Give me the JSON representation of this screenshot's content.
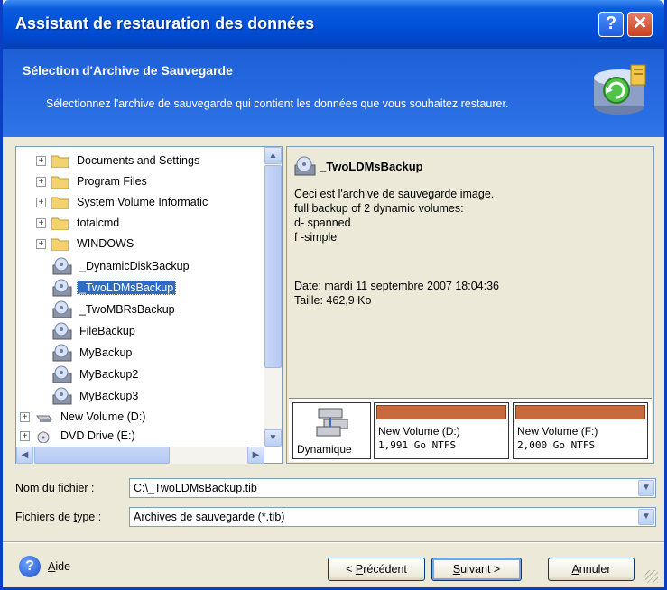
{
  "window": {
    "title": "Assistant de restauration des données",
    "help_glyph": "?",
    "close_glyph": "✕"
  },
  "header": {
    "title": "Sélection d'Archive de Sauvegarde",
    "description": "Sélectionnez l'archive de sauvegarde qui contient les données que vous souhaitez restaurer."
  },
  "tree": {
    "items": [
      {
        "label": "Documents and Settings",
        "kind": "folder",
        "expander": "+"
      },
      {
        "label": "Program Files",
        "kind": "folder",
        "expander": "+"
      },
      {
        "label": "System Volume Informatic",
        "kind": "folder",
        "expander": "+"
      },
      {
        "label": "totalcmd",
        "kind": "folder",
        "expander": "+"
      },
      {
        "label": "WINDOWS",
        "kind": "folder",
        "expander": "+"
      },
      {
        "label": "_DynamicDiskBackup",
        "kind": "archive"
      },
      {
        "label": "_TwoLDMsBackup",
        "kind": "archive",
        "selected": true
      },
      {
        "label": "_TwoMBRsBackup",
        "kind": "archive"
      },
      {
        "label": "FileBackup",
        "kind": "archive"
      },
      {
        "label": "MyBackup",
        "kind": "archive"
      },
      {
        "label": "MyBackup2",
        "kind": "archive"
      },
      {
        "label": "MyBackup3",
        "kind": "archive"
      },
      {
        "label": "New Volume (D:)",
        "kind": "drive",
        "expander": "+"
      },
      {
        "label": "DVD Drive (E:)",
        "kind": "dvd",
        "expander": "+"
      }
    ]
  },
  "info": {
    "title": "_TwoLDMsBackup",
    "description_lines": [
      "Ceci est l'archive de sauvegarde image.",
      "full backup of 2 dynamic volumes:",
      "d- spanned",
      "f -simple"
    ],
    "date": "Date: mardi 11 septembre 2007 18:04:36",
    "size": "Taille: 462,9 Ko",
    "dynamic_label": "Dynamique",
    "volumes": [
      {
        "name": "New Volume (D:)",
        "size": "1,991 Go  NTFS"
      },
      {
        "name": "New Volume (F:)",
        "size": "2,000 Go  NTFS"
      }
    ],
    "volume_color": "#c86a3c"
  },
  "fields": {
    "filename_label": "Nom du fichier :",
    "filename_value": "C:\\_TwoLDMsBackup.tib",
    "filetype_label_pre": "Fichiers de ",
    "filetype_label_u": "t",
    "filetype_label_post": "ype :",
    "filetype_value": "Archives de sauvegarde (*.tib)"
  },
  "buttons": {
    "help_pre": "",
    "help_u": "A",
    "help_post": "ide",
    "prev_pre": "< ",
    "prev_u": "P",
    "prev_post": "récédent",
    "next_u": "S",
    "next_post": "uivant >",
    "cancel_u": "A",
    "cancel_post": "nnuler"
  }
}
